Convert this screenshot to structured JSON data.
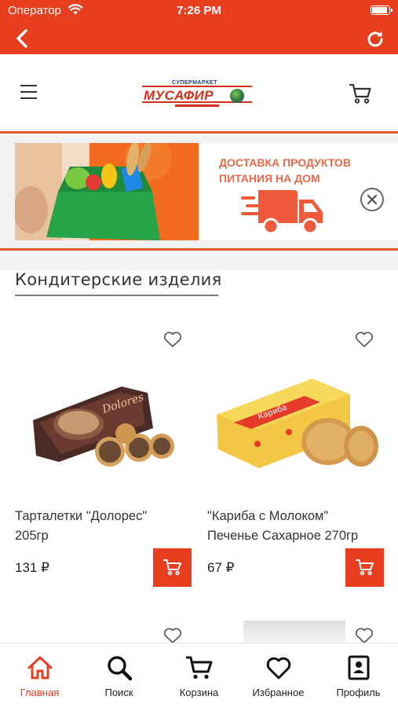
{
  "status_bar": {
    "carrier": "Оператор",
    "time": "7:26 PM",
    "battery_level": 1.0
  },
  "nav": {
    "back_icon": "chevron-left-icon",
    "reload_icon": "reload-icon"
  },
  "header": {
    "menu_icon": "hamburger-icon",
    "logo": {
      "top_text": "СУПЕРМАРКЕТ",
      "main_text": "МУСАФИР"
    },
    "cart_icon": "cart-icon"
  },
  "banner": {
    "title_line1": "ДОСТАВКА ПРОДУКТОВ",
    "title_line2": "ПИТАНИЯ НА ДОМ",
    "close_icon": "close-circle-icon"
  },
  "section": {
    "title": "Кондитерские изделия"
  },
  "products": [
    {
      "name_line1": "Тарталетки \"Долорес\"",
      "name_line2": "205гр",
      "price": "131 ₽"
    },
    {
      "name_line1": "\"Кариба с Молоком\"",
      "name_line2": "Печенье Сахарное 270гр",
      "price": "67 ₽"
    }
  ],
  "tabs": [
    {
      "label": "Главная",
      "icon": "home-icon",
      "active": true
    },
    {
      "label": "Поиск",
      "icon": "search-icon",
      "active": false
    },
    {
      "label": "Корзина",
      "icon": "cart-icon",
      "active": false
    },
    {
      "label": "Избранное",
      "icon": "heart-icon",
      "active": false
    },
    {
      "label": "Профиль",
      "icon": "profile-icon",
      "active": false
    }
  ],
  "colors": {
    "accent": "#e73e1f",
    "banner_text": "#e56a4b",
    "logo_red": "#d32f1c",
    "logo_blue": "#1e3f77"
  }
}
